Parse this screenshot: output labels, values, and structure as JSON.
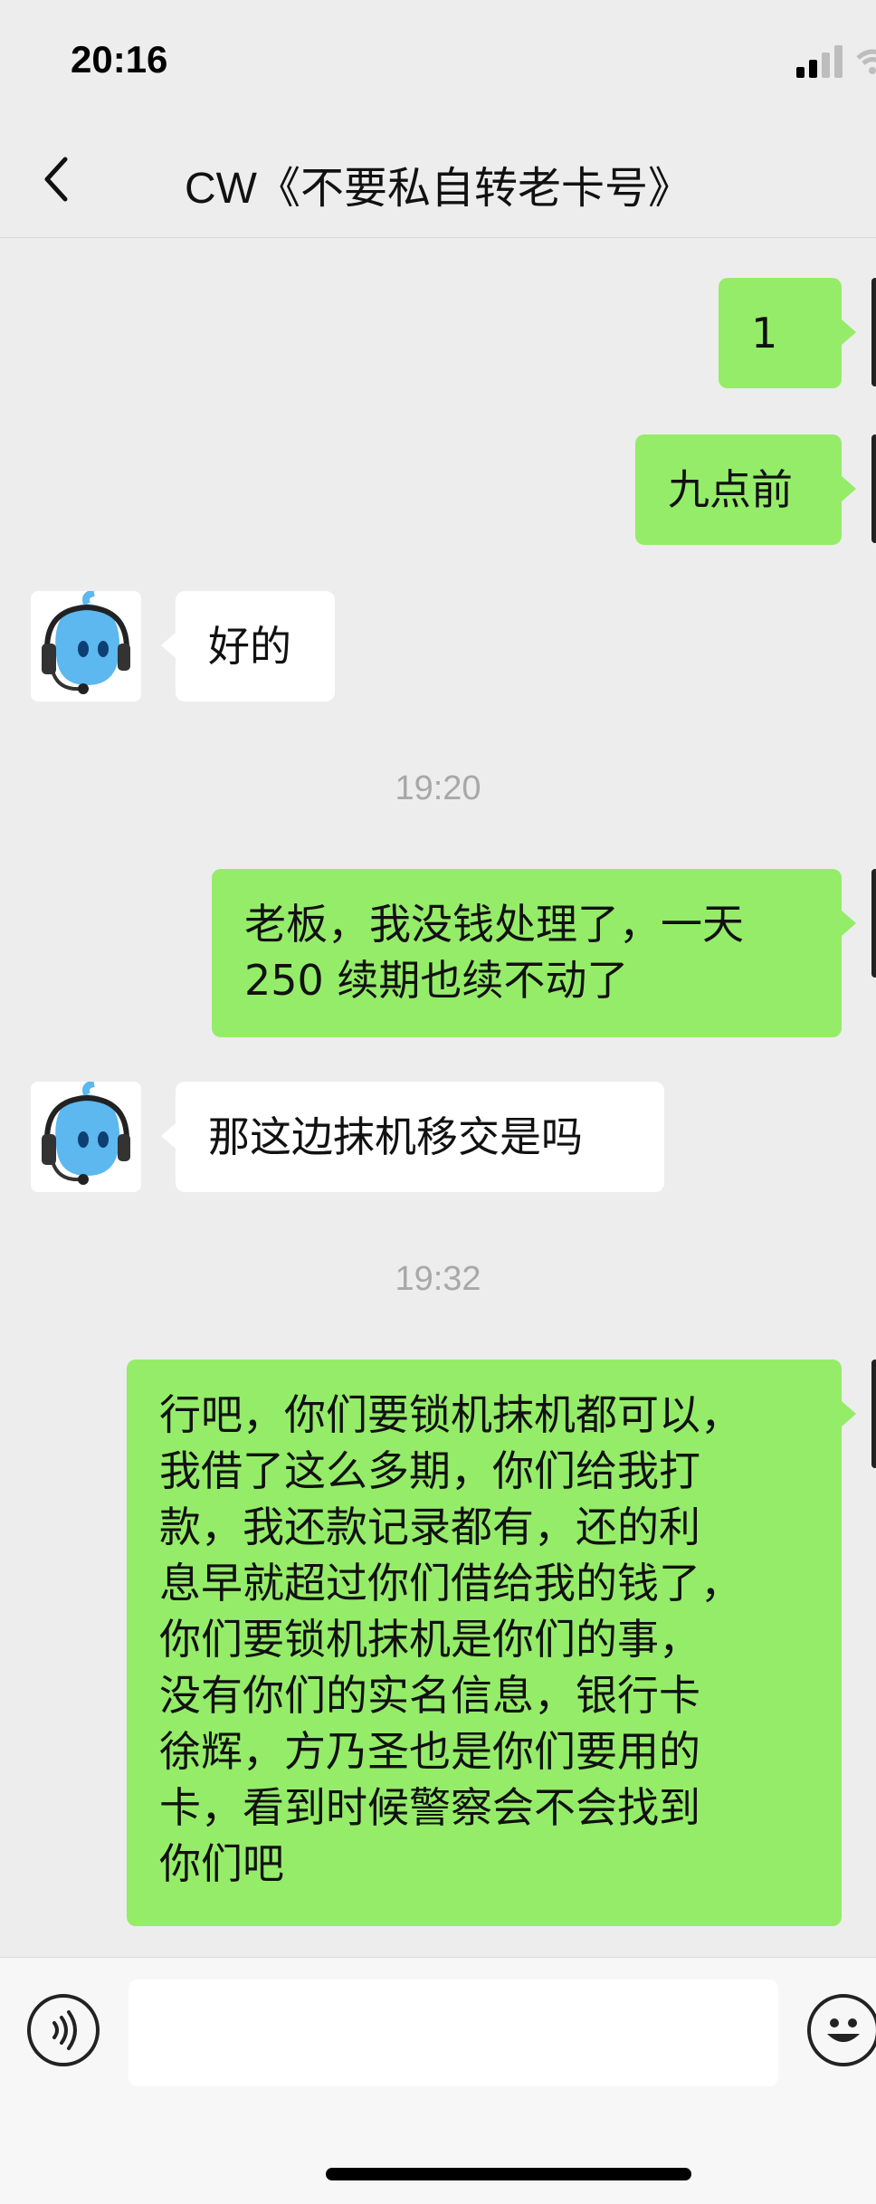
{
  "status_bar": {
    "time": "20:16"
  },
  "nav": {
    "title": "CW《不要私自转老卡号》"
  },
  "messages": [
    {
      "side": "right",
      "text": "1"
    },
    {
      "side": "right",
      "text": "九点前"
    },
    {
      "side": "left",
      "text": "好的"
    },
    {
      "timestamp": "19:20"
    },
    {
      "side": "right",
      "lines": [
        "老板，我没钱处理了，一天",
        "250 续期也续不动了"
      ]
    },
    {
      "side": "left",
      "text": "那这边抹机移交是吗"
    },
    {
      "timestamp": "19:32"
    },
    {
      "side": "right",
      "lines": [
        "行吧，你们要锁机抹机都可以，",
        "我借了这么多期，你们给我打",
        "款，我还款记录都有，还的利",
        "息早就超过你们借给我的钱了，",
        "你们要锁机抹机是你们的事，",
        "没有你们的实名信息，银行卡",
        "徐辉，方乃圣也是你们要用的",
        "卡，看到时候警察会不会找到",
        "你们吧"
      ]
    }
  ],
  "input_bar": {
    "value": ""
  },
  "colors": {
    "self_bubble": "#95ec69",
    "other_bubble": "#ffffff",
    "background": "#ededed"
  },
  "icons": [
    "back-arrow",
    "voice",
    "emoji",
    "signal",
    "wifi"
  ]
}
